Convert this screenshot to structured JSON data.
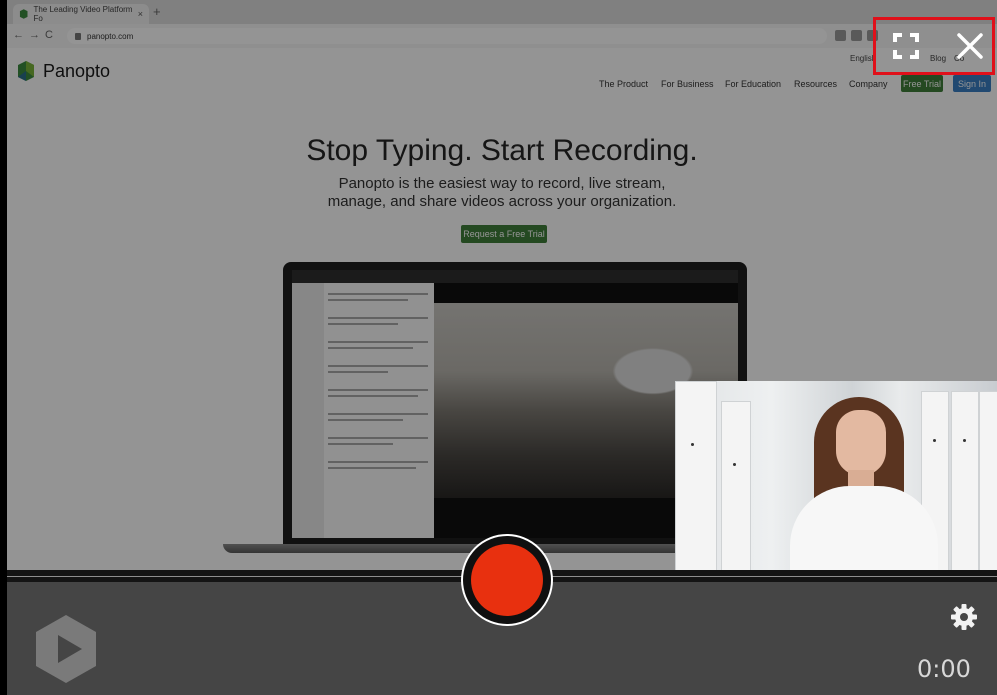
{
  "browser": {
    "tab_title": "The Leading Video Platform Fo",
    "tab_close": "×",
    "new_tab": "+",
    "url": "panopto.com",
    "back": "←",
    "forward": "→",
    "reload": "C"
  },
  "site": {
    "logo_text": "Panopto",
    "top_links": [
      "English",
      "Blog",
      "Co"
    ],
    "nav": [
      "The Product",
      "For Business",
      "For Education",
      "Resources",
      "Company"
    ],
    "free_trial": "Free Trial",
    "sign_in": "Sign In",
    "headline": "Stop Typing. Start Recording.",
    "sub1": "Panopto is the easiest way to record, live stream,",
    "sub2": "manage, and share videos across your organization.",
    "cta": "Request a Free Trial"
  },
  "recorder": {
    "timer": "0:00",
    "icons": {
      "fullscreen": "fullscreen-icon",
      "close": "close-icon",
      "settings": "gear-icon",
      "record": "record-button",
      "logo": "panopto-logo-icon"
    },
    "colors": {
      "record": "#e8300f",
      "bar": "#454545",
      "highlight": "#e0101a"
    }
  }
}
